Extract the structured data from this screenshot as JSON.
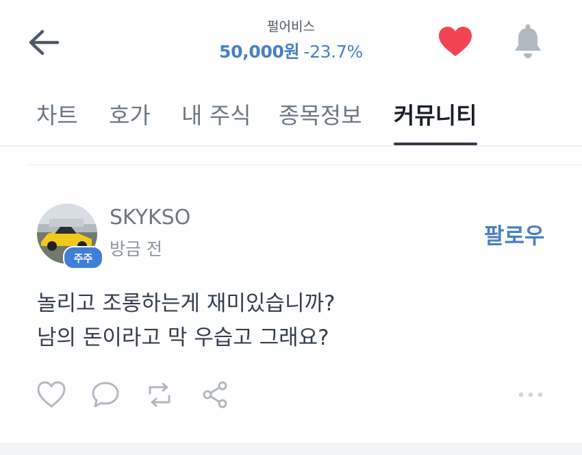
{
  "header": {
    "stock_name": "펄어비스",
    "price": "50,000원",
    "change": "-23.7%"
  },
  "icons": {
    "back": "arrow-left-icon",
    "favorite": "heart-icon",
    "notification": "bell-icon",
    "like": "heart-outline-icon",
    "comment": "speech-bubble-icon",
    "repost": "repost-icon",
    "share": "share-icon",
    "more": "more-dots-icon"
  },
  "colors": {
    "price_blue": "#4a7fc1",
    "favorite_red": "#f04452",
    "badge_blue": "#3f7fd9"
  },
  "tabs": [
    {
      "label": "차트",
      "active": false
    },
    {
      "label": "호가",
      "active": false
    },
    {
      "label": "내 주식",
      "active": false
    },
    {
      "label": "종목정보",
      "active": false
    },
    {
      "label": "커뮤니티",
      "active": true
    }
  ],
  "post": {
    "username": "SKYKSO",
    "badge": "주주",
    "time": "방금 전",
    "follow_label": "팔로우",
    "lines": [
      "놀리고 조롱하는게 재미있습니까?",
      "남의 돈이라고 막 우습고 그래요?"
    ]
  }
}
